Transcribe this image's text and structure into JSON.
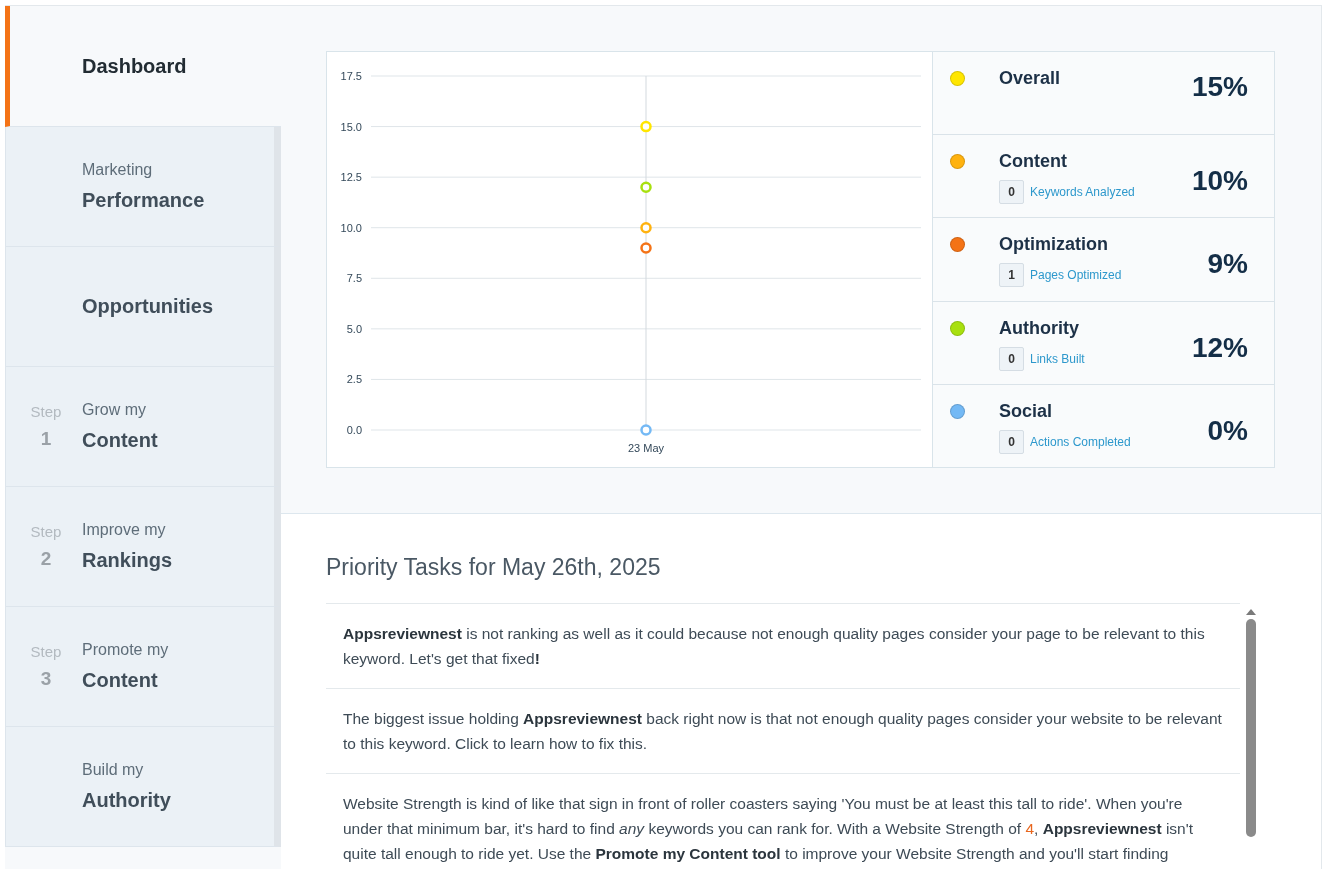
{
  "sidebar": {
    "items": [
      {
        "title": "Dashboard",
        "selected": true
      },
      {
        "prefix": "Marketing",
        "title": "Performance",
        "selected": false
      },
      {
        "title": "Opportunities",
        "selected": false
      },
      {
        "step": "Step",
        "number": "1",
        "prefix": "Grow my",
        "title": "Content",
        "selected": false
      },
      {
        "step": "Step",
        "number": "2",
        "prefix": "Improve my",
        "title": "Rankings",
        "selected": false
      },
      {
        "step": "Step",
        "number": "3",
        "prefix": "Promote my",
        "title": "Content",
        "selected": false
      },
      {
        "prefix": "Build my",
        "title": "Authority",
        "selected": false
      }
    ]
  },
  "chart": {
    "chart_data": {
      "type": "scatter",
      "grid": true,
      "categories": [
        "23 May"
      ],
      "ref_lines": [
        {
          "axis": "x",
          "value": "23 May"
        }
      ],
      "ylim": [
        0,
        17.5
      ],
      "yticks": [
        {
          "value": 0,
          "label": "0.0"
        },
        {
          "value": 2.5,
          "label": "2.5"
        },
        {
          "value": 5,
          "label": "5.0"
        },
        {
          "value": 7.5,
          "label": "7.5"
        },
        {
          "value": 10,
          "label": "10.0"
        },
        {
          "value": 12.5,
          "label": "12.5"
        },
        {
          "value": 15,
          "label": "15.0"
        },
        {
          "value": 17.5,
          "label": "17.5"
        }
      ],
      "series": [
        {
          "name": "Overall",
          "color": "#ffe600",
          "values": [
            15
          ]
        },
        {
          "name": "Content",
          "color": "#ffb20f",
          "values": [
            10
          ]
        },
        {
          "name": "Optimization",
          "color": "#f47316",
          "values": [
            9
          ]
        },
        {
          "name": "Authority",
          "color": "#a8e00f",
          "values": [
            12
          ]
        },
        {
          "name": "Social",
          "color": "#74b9f5",
          "values": [
            0
          ]
        }
      ]
    }
  },
  "stats": [
    {
      "percent": "15%"
    },
    {
      "percent": "10%",
      "count": "0",
      "metric": "Keywords Analyzed"
    },
    {
      "percent": "9%",
      "count": "1",
      "metric": "Pages Optimized"
    },
    {
      "percent": "12%",
      "count": "0",
      "metric": "Links Built"
    },
    {
      "percent": "0%",
      "count": "0",
      "metric": "Actions Completed"
    }
  ],
  "priority_tasks": {
    "title": "Priority Tasks for May 26th, 2025",
    "tasks": [
      [
        {
          "kind": "plain",
          "text": "**Appsreviewnest** is not ranking as well as it could because not enough quality pages consider your page to be relevant to this keyword. Let's get that fixed**!**"
        }
      ],
      [
        {
          "kind": "plain",
          "text": "The biggest issue holding **Appsreviewnest** back right now is that not enough quality pages consider your website to be relevant to this keyword. Click to learn how to fix this."
        }
      ],
      [
        {
          "kind": "plain",
          "text": "Website Strength is kind of like that sign in front of roller coasters saying 'You must be at least this tall to ride'. When you're under that minimum bar, it's hard to find *any* keywords you can rank for. With a Website Strength of "
        },
        {
          "kind": "accent",
          "text": "4"
        },
        {
          "kind": "plain",
          "text": ", **Appsreviewnest** isn't quite tall enough to ride yet. Use the **Promote my Content tool** to improve your Website Strength and you'll start finding"
        }
      ]
    ]
  }
}
